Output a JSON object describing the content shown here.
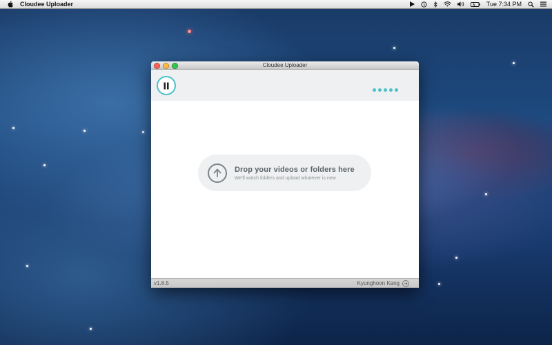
{
  "menubar": {
    "app_name": "Cloudee Uploader",
    "clock": "Tue 7:34 PM",
    "icons": [
      "play-icon",
      "time-machine-icon",
      "bluetooth-icon",
      "wifi-icon",
      "sound-icon",
      "battery-icon",
      "spotlight-icon",
      "list-icon"
    ]
  },
  "window": {
    "title": "Cloudee Uploader",
    "accent_color": "#4cc1c9",
    "dropzone": {
      "title": "Drop your videos or folders here",
      "subtitle": "We'll watch folders and upload whatever is new"
    },
    "status": {
      "version": "v1.8.5",
      "user": "Kyunghoon Kang"
    }
  }
}
